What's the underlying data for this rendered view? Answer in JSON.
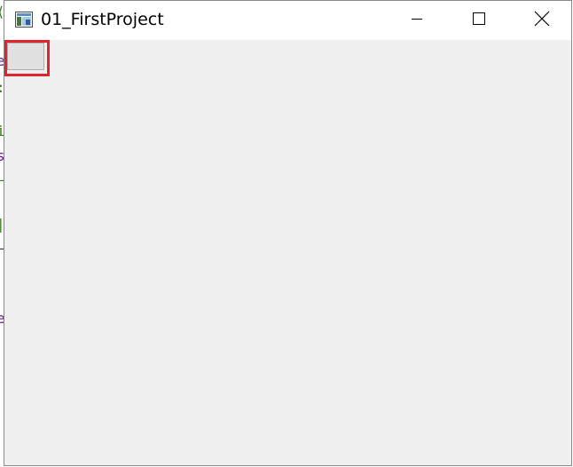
{
  "window": {
    "title": "01_FirstProject"
  },
  "icons": {
    "app": "app-window-icon",
    "minimize": "minimize-icon",
    "maximize": "maximize-icon",
    "close": "close-icon"
  },
  "colors": {
    "titlebar_bg": "#ffffff",
    "client_bg": "#f0f0f0",
    "button_bg": "#e1e1e1",
    "highlight_border": "#e3232b"
  },
  "background_fragments": [
    "e",
    "s",
    "e"
  ]
}
